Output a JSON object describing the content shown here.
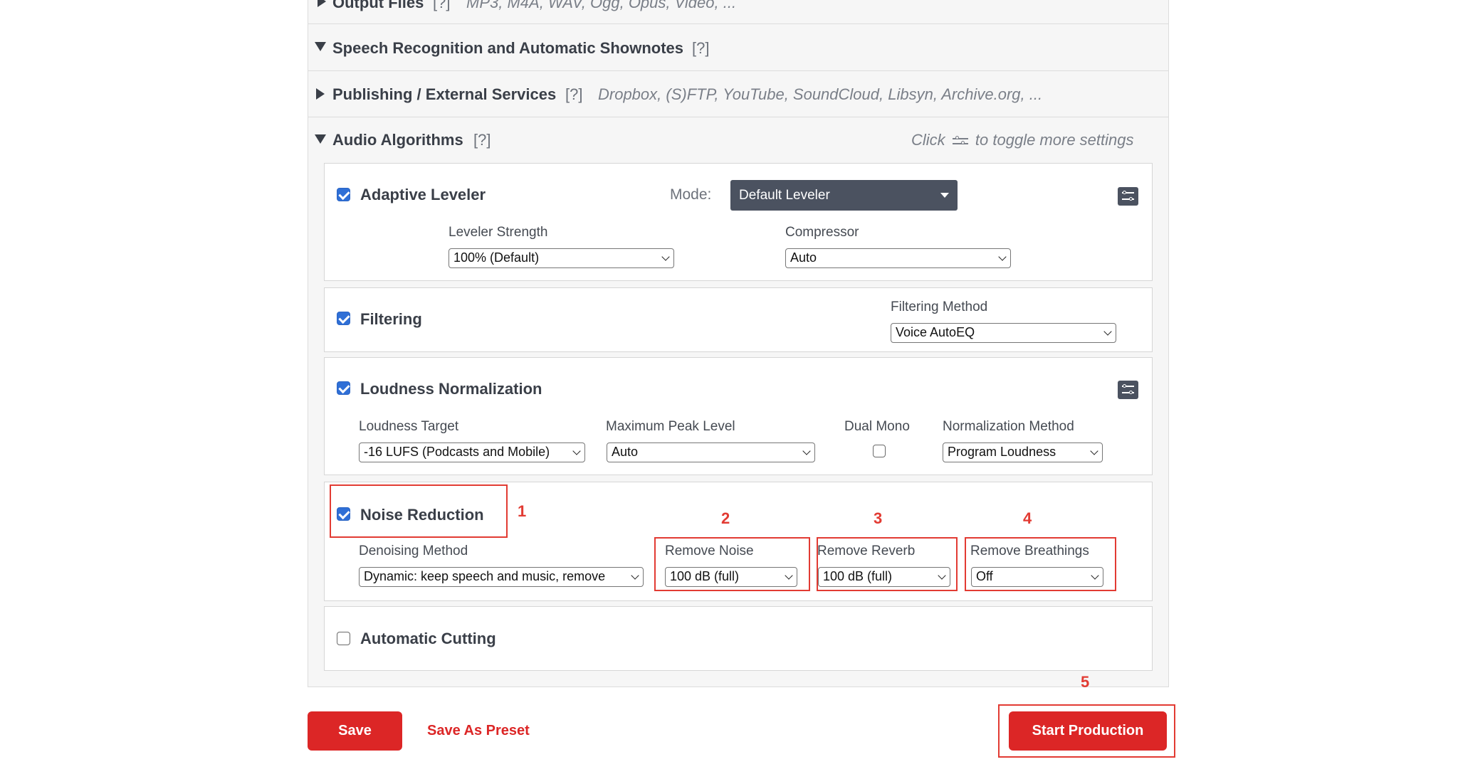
{
  "sections": {
    "output_files": {
      "title": "Output Files",
      "help": "[?]",
      "note": "MP3, M4A, WAV, Ogg, Opus, Video, ..."
    },
    "speech": {
      "title": "Speech Recognition and Automatic Shownotes",
      "help": "[?]"
    },
    "publishing": {
      "title": "Publishing / External Services",
      "help": "[?]",
      "note": "Dropbox, (S)FTP, YouTube, SoundCloud, Libsyn, Archive.org, ..."
    },
    "audio": {
      "title": "Audio Algorithms",
      "help": "[?]",
      "note_prefix": "Click",
      "note_suffix": "to toggle more settings",
      "toggle_icon": "sliders-icon"
    }
  },
  "adaptive_leveler": {
    "title": "Adaptive Leveler",
    "checked": true,
    "mode_label": "Mode:",
    "mode_value": "Default Leveler",
    "strength_label": "Leveler Strength",
    "strength_value": "100% (Default)",
    "compressor_label": "Compressor",
    "compressor_value": "Auto",
    "settings_icon": "sliders-icon"
  },
  "filtering": {
    "title": "Filtering",
    "checked": true,
    "method_label": "Filtering Method",
    "method_value": "Voice AutoEQ"
  },
  "loudness": {
    "title": "Loudness Normalization",
    "checked": true,
    "target_label": "Loudness Target",
    "target_value": "-16 LUFS (Podcasts and Mobile)",
    "peak_label": "Maximum Peak Level",
    "peak_value": "Auto",
    "dual_mono_label": "Dual Mono",
    "dual_mono_checked": false,
    "method_label": "Normalization Method",
    "method_value": "Program Loudness",
    "settings_icon": "sliders-icon"
  },
  "noise_reduction": {
    "title": "Noise Reduction",
    "checked": true,
    "method_label": "Denoising Method",
    "method_value": "Dynamic: keep speech and music, remove",
    "noise_label": "Remove Noise",
    "noise_value": "100 dB (full)",
    "reverb_label": "Remove Reverb",
    "reverb_value": "100 dB (full)",
    "breath_label": "Remove Breathings",
    "breath_value": "Off"
  },
  "cutting": {
    "title": "Automatic Cutting",
    "checked": false
  },
  "footer": {
    "save_label": "Save",
    "preset_label": "Save As Preset",
    "start_label": "Start Production"
  },
  "annotations": {
    "n1": "1",
    "n2": "2",
    "n3": "3",
    "n4": "4",
    "n5": "5",
    "color": "#e23b33"
  },
  "colors": {
    "accent_red": "#dc2626",
    "checkbox_blue": "#2f6fd6",
    "dark_select": "#4b5260"
  }
}
